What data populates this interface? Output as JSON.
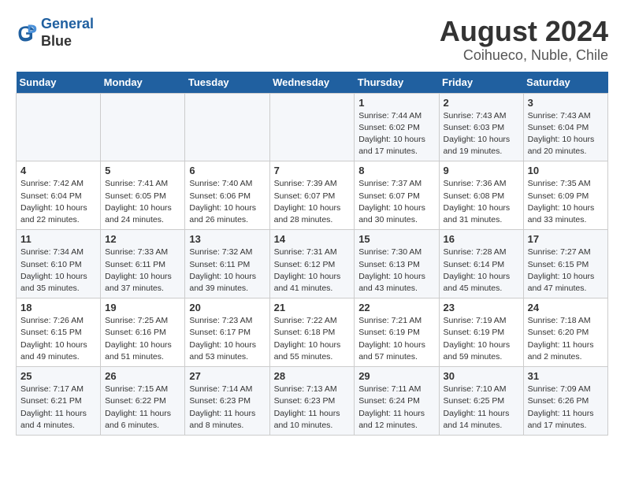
{
  "header": {
    "logo_line1": "General",
    "logo_line2": "Blue",
    "title": "August 2024",
    "subtitle": "Coihueco, Nuble, Chile"
  },
  "weekdays": [
    "Sunday",
    "Monday",
    "Tuesday",
    "Wednesday",
    "Thursday",
    "Friday",
    "Saturday"
  ],
  "weeks": [
    [
      {
        "day": "",
        "info": ""
      },
      {
        "day": "",
        "info": ""
      },
      {
        "day": "",
        "info": ""
      },
      {
        "day": "",
        "info": ""
      },
      {
        "day": "1",
        "info": "Sunrise: 7:44 AM\nSunset: 6:02 PM\nDaylight: 10 hours\nand 17 minutes."
      },
      {
        "day": "2",
        "info": "Sunrise: 7:43 AM\nSunset: 6:03 PM\nDaylight: 10 hours\nand 19 minutes."
      },
      {
        "day": "3",
        "info": "Sunrise: 7:43 AM\nSunset: 6:04 PM\nDaylight: 10 hours\nand 20 minutes."
      }
    ],
    [
      {
        "day": "4",
        "info": "Sunrise: 7:42 AM\nSunset: 6:04 PM\nDaylight: 10 hours\nand 22 minutes."
      },
      {
        "day": "5",
        "info": "Sunrise: 7:41 AM\nSunset: 6:05 PM\nDaylight: 10 hours\nand 24 minutes."
      },
      {
        "day": "6",
        "info": "Sunrise: 7:40 AM\nSunset: 6:06 PM\nDaylight: 10 hours\nand 26 minutes."
      },
      {
        "day": "7",
        "info": "Sunrise: 7:39 AM\nSunset: 6:07 PM\nDaylight: 10 hours\nand 28 minutes."
      },
      {
        "day": "8",
        "info": "Sunrise: 7:37 AM\nSunset: 6:07 PM\nDaylight: 10 hours\nand 30 minutes."
      },
      {
        "day": "9",
        "info": "Sunrise: 7:36 AM\nSunset: 6:08 PM\nDaylight: 10 hours\nand 31 minutes."
      },
      {
        "day": "10",
        "info": "Sunrise: 7:35 AM\nSunset: 6:09 PM\nDaylight: 10 hours\nand 33 minutes."
      }
    ],
    [
      {
        "day": "11",
        "info": "Sunrise: 7:34 AM\nSunset: 6:10 PM\nDaylight: 10 hours\nand 35 minutes."
      },
      {
        "day": "12",
        "info": "Sunrise: 7:33 AM\nSunset: 6:11 PM\nDaylight: 10 hours\nand 37 minutes."
      },
      {
        "day": "13",
        "info": "Sunrise: 7:32 AM\nSunset: 6:11 PM\nDaylight: 10 hours\nand 39 minutes."
      },
      {
        "day": "14",
        "info": "Sunrise: 7:31 AM\nSunset: 6:12 PM\nDaylight: 10 hours\nand 41 minutes."
      },
      {
        "day": "15",
        "info": "Sunrise: 7:30 AM\nSunset: 6:13 PM\nDaylight: 10 hours\nand 43 minutes."
      },
      {
        "day": "16",
        "info": "Sunrise: 7:28 AM\nSunset: 6:14 PM\nDaylight: 10 hours\nand 45 minutes."
      },
      {
        "day": "17",
        "info": "Sunrise: 7:27 AM\nSunset: 6:15 PM\nDaylight: 10 hours\nand 47 minutes."
      }
    ],
    [
      {
        "day": "18",
        "info": "Sunrise: 7:26 AM\nSunset: 6:15 PM\nDaylight: 10 hours\nand 49 minutes."
      },
      {
        "day": "19",
        "info": "Sunrise: 7:25 AM\nSunset: 6:16 PM\nDaylight: 10 hours\nand 51 minutes."
      },
      {
        "day": "20",
        "info": "Sunrise: 7:23 AM\nSunset: 6:17 PM\nDaylight: 10 hours\nand 53 minutes."
      },
      {
        "day": "21",
        "info": "Sunrise: 7:22 AM\nSunset: 6:18 PM\nDaylight: 10 hours\nand 55 minutes."
      },
      {
        "day": "22",
        "info": "Sunrise: 7:21 AM\nSunset: 6:19 PM\nDaylight: 10 hours\nand 57 minutes."
      },
      {
        "day": "23",
        "info": "Sunrise: 7:19 AM\nSunset: 6:19 PM\nDaylight: 10 hours\nand 59 minutes."
      },
      {
        "day": "24",
        "info": "Sunrise: 7:18 AM\nSunset: 6:20 PM\nDaylight: 11 hours\nand 2 minutes."
      }
    ],
    [
      {
        "day": "25",
        "info": "Sunrise: 7:17 AM\nSunset: 6:21 PM\nDaylight: 11 hours\nand 4 minutes."
      },
      {
        "day": "26",
        "info": "Sunrise: 7:15 AM\nSunset: 6:22 PM\nDaylight: 11 hours\nand 6 minutes."
      },
      {
        "day": "27",
        "info": "Sunrise: 7:14 AM\nSunset: 6:23 PM\nDaylight: 11 hours\nand 8 minutes."
      },
      {
        "day": "28",
        "info": "Sunrise: 7:13 AM\nSunset: 6:23 PM\nDaylight: 11 hours\nand 10 minutes."
      },
      {
        "day": "29",
        "info": "Sunrise: 7:11 AM\nSunset: 6:24 PM\nDaylight: 11 hours\nand 12 minutes."
      },
      {
        "day": "30",
        "info": "Sunrise: 7:10 AM\nSunset: 6:25 PM\nDaylight: 11 hours\nand 14 minutes."
      },
      {
        "day": "31",
        "info": "Sunrise: 7:09 AM\nSunset: 6:26 PM\nDaylight: 11 hours\nand 17 minutes."
      }
    ]
  ]
}
